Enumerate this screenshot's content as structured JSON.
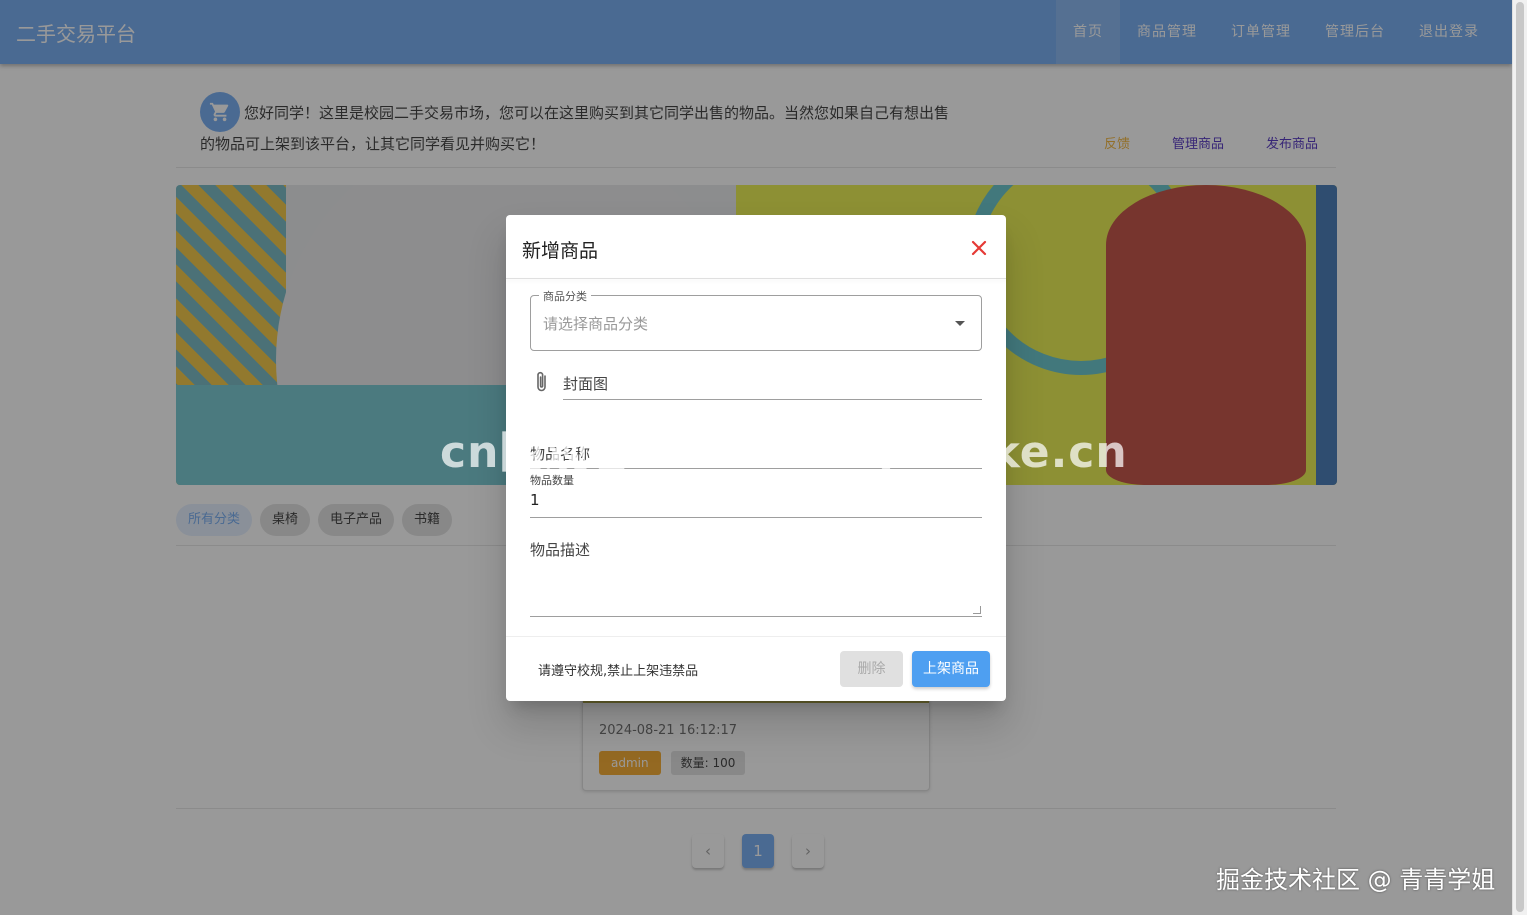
{
  "header": {
    "brand": "二手交易平台",
    "nav": [
      "首页",
      "商品管理",
      "订单管理",
      "管理后台",
      "退出登录"
    ]
  },
  "intro": {
    "text": "您好同学！这里是校园二手交易市场，您可以在这里购买到其它同学出售的物品。当然您如果自己有想出售的物品可上架到该平台，让其它同学看见并购买它！",
    "feedback": "反馈",
    "manage_goods": "管理商品",
    "publish_goods": "发布商品"
  },
  "categories": [
    "所有分类",
    "桌椅",
    "电子产品",
    "书籍"
  ],
  "card": {
    "date": "2024-08-21 16:12:17",
    "owner": "admin",
    "quantity": "数量: 100"
  },
  "pagination": {
    "prev": "‹",
    "current": "1",
    "next": "›"
  },
  "dialog": {
    "title": "新增商品",
    "category_label": "商品分类",
    "category_placeholder": "请选择商品分类",
    "cover_label": "封面图",
    "name_label": "物品名称",
    "quantity_label": "物品数量",
    "quantity_value": "1",
    "description_label": "物品描述",
    "note": "请遵守校规,禁止上架违禁品",
    "delete_label": "删除",
    "publish_label": "上架商品"
  },
  "watermarks": {
    "center": "cn围观客www.weiguanke.cn",
    "corner": "掘金技术社区 @ 青青学姐"
  },
  "colors": {
    "primary": "#6ea8f2",
    "accent_button": "#4e9ff1",
    "close_icon": "#e53935",
    "owner_tag": "#f6a623",
    "feedback_link": "#f3b12f",
    "links": "#4a2ac0"
  },
  "icons": [
    "cart-icon",
    "close-icon",
    "paperclip-icon",
    "dropdown-arrow-icon",
    "chevron-left-icon",
    "chevron-right-icon"
  ]
}
